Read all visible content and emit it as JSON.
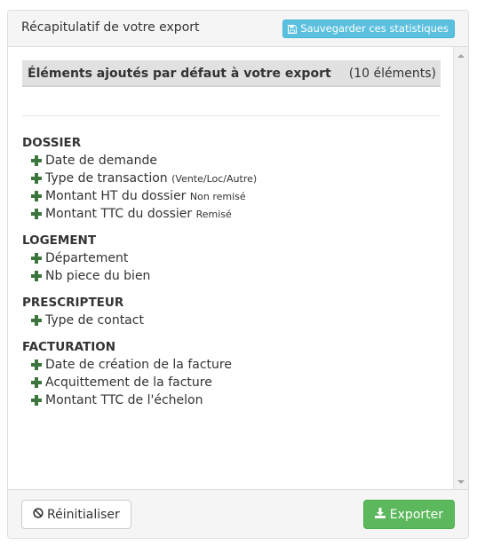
{
  "header": {
    "title": "Récapitulatif de votre export",
    "save_label": "Sauvegarder ces statistiques"
  },
  "summary": {
    "title": "Éléments ajoutés par défaut à votre export",
    "count": "(10 éléments)"
  },
  "groups": [
    {
      "title": "DOSSIER",
      "items": [
        {
          "label": "Date de demande",
          "note": ""
        },
        {
          "label": "Type de transaction",
          "note": "(Vente/Loc/Autre)"
        },
        {
          "label": "Montant HT du dossier",
          "note": "Non remisé"
        },
        {
          "label": "Montant TTC du dossier",
          "note": "Remisé"
        }
      ]
    },
    {
      "title": "LOGEMENT",
      "items": [
        {
          "label": "Département",
          "note": ""
        },
        {
          "label": "Nb piece du bien",
          "note": ""
        }
      ]
    },
    {
      "title": "PRESCRIPTEUR",
      "items": [
        {
          "label": "Type de contact",
          "note": ""
        }
      ]
    },
    {
      "title": "FACTURATION",
      "items": [
        {
          "label": "Date de création de la facture",
          "note": ""
        },
        {
          "label": "Acquittement de la facture",
          "note": ""
        },
        {
          "label": "Montant TTC de l'échelon",
          "note": ""
        }
      ]
    }
  ],
  "footer": {
    "reset_label": "Réinitialiser",
    "export_label": "Exporter"
  },
  "icons": {
    "save": "floppy-disk-icon",
    "reset": "ban-icon",
    "export": "download-icon",
    "item": "plus-icon"
  },
  "colors": {
    "info": "#5bc0de",
    "success": "#5cb85c",
    "plus": "#3c763d",
    "summary_bg": "#e1e1e1"
  }
}
